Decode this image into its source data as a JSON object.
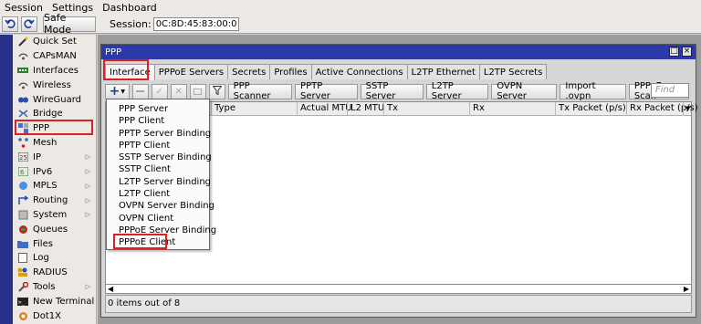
{
  "menubar": {
    "items": [
      "Session",
      "Settings",
      "Dashboard"
    ]
  },
  "toolbar": {
    "undo_icon": "undo-icon",
    "redo_icon": "redo-icon",
    "safe_mode_label": "Safe Mode",
    "session_label": "Session:",
    "session_value": "0C:8D:45:83:00:0"
  },
  "sidebar": {
    "items": [
      {
        "label": "Quick Set",
        "icon": "wand-icon",
        "submenu": false
      },
      {
        "label": "CAPsMAN",
        "icon": "wireless-icon",
        "submenu": false
      },
      {
        "label": "Interfaces",
        "icon": "interfaces-icon",
        "submenu": false
      },
      {
        "label": "Wireless",
        "icon": "wireless-icon",
        "submenu": false
      },
      {
        "label": "WireGuard",
        "icon": "wireguard-icon",
        "submenu": false
      },
      {
        "label": "Bridge",
        "icon": "bridge-icon",
        "submenu": false
      },
      {
        "label": "PPP",
        "icon": "ppp-icon",
        "submenu": false
      },
      {
        "label": "Mesh",
        "icon": "mesh-icon",
        "submenu": false
      },
      {
        "label": "IP",
        "icon": "ip-icon",
        "submenu": true
      },
      {
        "label": "IPv6",
        "icon": "ipv6-icon",
        "submenu": true
      },
      {
        "label": "MPLS",
        "icon": "mpls-icon",
        "submenu": true
      },
      {
        "label": "Routing",
        "icon": "routing-icon",
        "submenu": true
      },
      {
        "label": "System",
        "icon": "system-icon",
        "submenu": true
      },
      {
        "label": "Queues",
        "icon": "queues-icon",
        "submenu": false
      },
      {
        "label": "Files",
        "icon": "folder-icon",
        "submenu": false
      },
      {
        "label": "Log",
        "icon": "log-icon",
        "submenu": false
      },
      {
        "label": "RADIUS",
        "icon": "radius-icon",
        "submenu": false
      },
      {
        "label": "Tools",
        "icon": "tools-icon",
        "submenu": true
      },
      {
        "label": "New Terminal",
        "icon": "terminal-icon",
        "submenu": false
      },
      {
        "label": "Dot1X",
        "icon": "dot1x-icon",
        "submenu": false
      }
    ]
  },
  "window": {
    "title": "PPP",
    "tabs": [
      "Interface",
      "PPPoE Servers",
      "Secrets",
      "Profiles",
      "Active Connections",
      "L2TP Ethernet",
      "L2TP Secrets"
    ],
    "active_tab": "Interface",
    "buttons": [
      "PPP Scanner",
      "PPTP Server",
      "SSTP Server",
      "L2TP Server",
      "OVPN Server",
      "Import .ovpn",
      "PPPoE Scan"
    ],
    "find_placeholder": "Find",
    "columns": [
      "Type",
      "Actual MTU",
      "L2 MTU",
      "Tx",
      "Rx",
      "Tx Packet (p/s)",
      "Rx Packet (p/s)"
    ],
    "status": "0 items out of 8"
  },
  "dropdown": {
    "items": [
      "PPP Server",
      "PPP Client",
      "PPTP Server Binding",
      "PPTP Client",
      "SSTP Server Binding",
      "SSTP Client",
      "L2TP Server Binding",
      "L2TP Client",
      "OVPN Server Binding",
      "OVPN Client",
      "PPPoE Server Binding",
      "PPPoE Client"
    ]
  },
  "colors": {
    "highlight": "#e02020",
    "titlebar": "#2c39a8",
    "sidebar_strip": "#26318a"
  }
}
